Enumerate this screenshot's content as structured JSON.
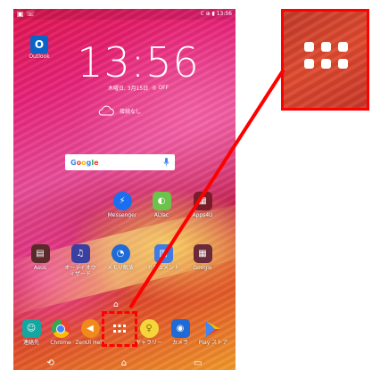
{
  "statusbar": {
    "left": "▣ ☏",
    "right": "ℂ ⊕ ▮ 13:56"
  },
  "clock": {
    "time": "13:56",
    "date": "木曜日, 3月15日",
    "alarm": "◎ OFF"
  },
  "weather": {
    "text": "接続なし"
  },
  "search": {
    "logo": "Google"
  },
  "home_apps": [
    {
      "label": "Outlook"
    },
    {
      "label": "Messenger"
    },
    {
      "label": "ALYac"
    },
    {
      "label": "Apps4U"
    },
    {
      "label": "Asus"
    },
    {
      "label": "オーディオウィザード"
    },
    {
      "label": "メモリ解放"
    },
    {
      "label": "ドキュメント"
    },
    {
      "label": "Google"
    }
  ],
  "dock": [
    {
      "label": "連絡先"
    },
    {
      "label": "Chrome"
    },
    {
      "label": "ZenUI Help"
    },
    {
      "label": ""
    },
    {
      "label": "ギャラリー"
    },
    {
      "label": "カメラ"
    },
    {
      "label": "Play ストア"
    }
  ],
  "nav": {
    "back": "⟲",
    "home": "⌂",
    "recent": "▭"
  },
  "colors": {
    "highlight": "#ff0000"
  }
}
